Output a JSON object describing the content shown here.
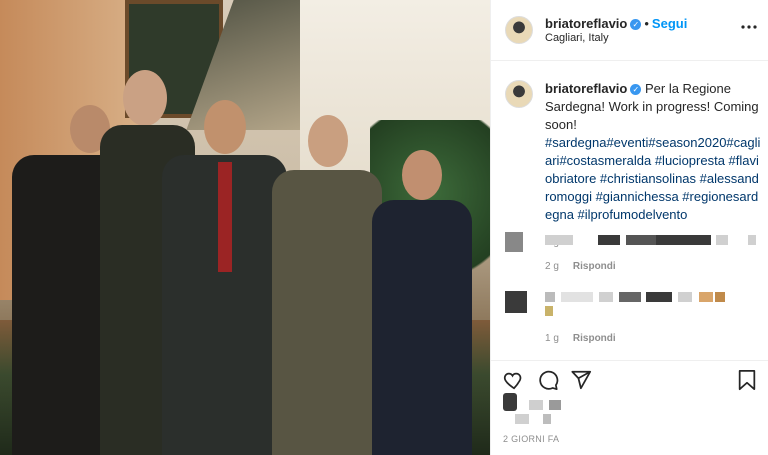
{
  "post": {
    "username": "briatoreflavio",
    "verified_badge": "✓",
    "separator": "•",
    "follow_label": "Segui",
    "location": "Cagliari, Italy",
    "more_icon": "more-horizontal-icon",
    "caption_text": "Per la Regione Sardegna! Work in progress! Coming soon!",
    "caption_tags": "#sardegna#eventi#season2020#cagliari#costasmeralda #luciopresta #flaviobriatore #christiansolinas #alessandromoggi #giannichessa #regionesardegna #ilprofumodelvento",
    "caption_age": "2 g",
    "comments": [
      {
        "age": "2 g",
        "reply_label": "Rispondi"
      },
      {
        "age": "1 g",
        "reply_label": "Rispondi"
      }
    ],
    "actions": {
      "like_icon": "heart-icon",
      "comment_icon": "comment-icon",
      "share_icon": "send-icon",
      "save_icon": "bookmark-icon"
    },
    "timestamp": "2 GIORNI FA"
  },
  "colors": {
    "link": "#00376b",
    "follow": "#0095f6",
    "verified": "#3897f0",
    "meta": "#8e8e8e"
  }
}
